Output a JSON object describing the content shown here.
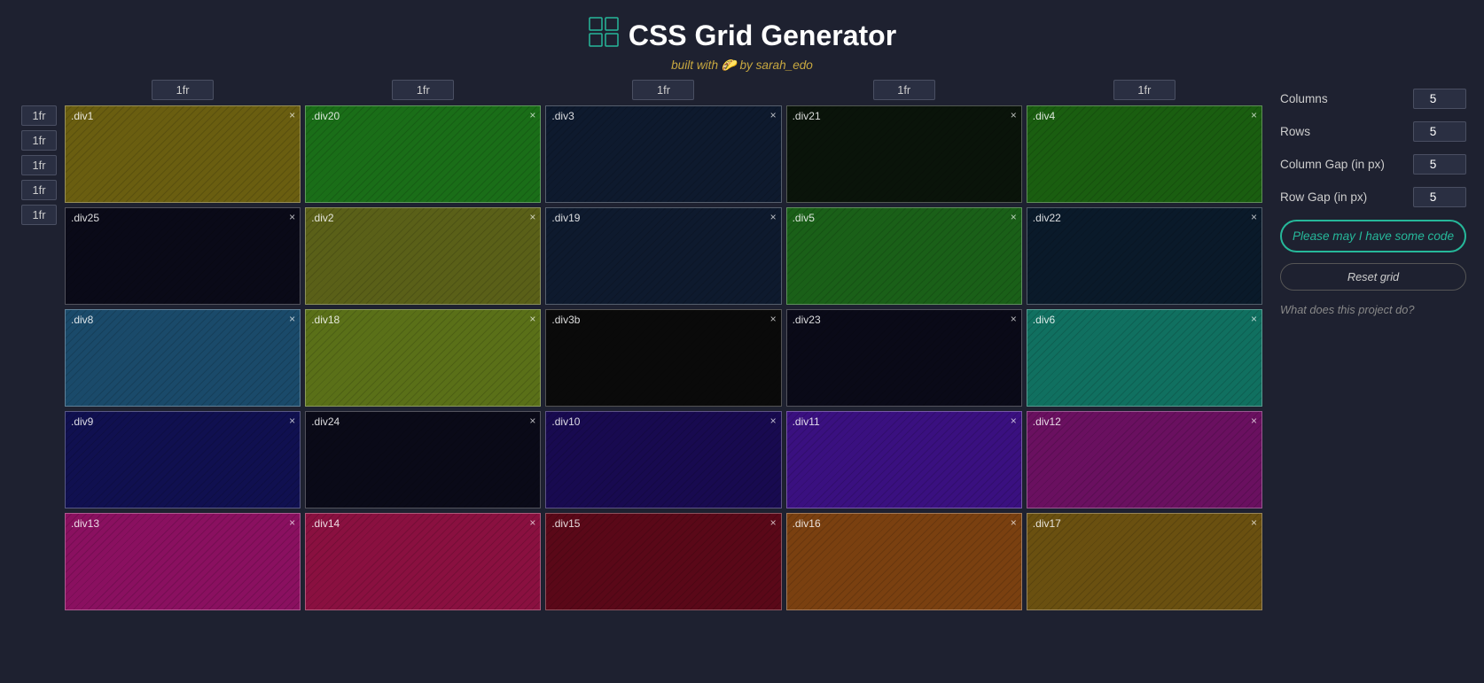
{
  "header": {
    "title": "CSS Grid Generator",
    "subtitle": "built with 🌮 by sarah_edo"
  },
  "column_labels": [
    "1fr",
    "1fr",
    "1fr",
    "1fr",
    "1fr"
  ],
  "row_labels": [
    "1fr",
    "1fr",
    "1fr",
    "1fr",
    "1fr"
  ],
  "grid_cells": [
    {
      "id": "div1",
      "color": "#6b6010",
      "row": 1,
      "col": 1
    },
    {
      "id": "div20",
      "color": "#1e6e18",
      "row": 1,
      "col": 2
    },
    {
      "id": "div3",
      "color": "#0a1a2a",
      "row": 1,
      "col": 3
    },
    {
      "id": "div21",
      "color": "#0a1a0a",
      "row": 1,
      "col": 4
    },
    {
      "id": "div4",
      "color": "#1a6010",
      "row": 1,
      "col": 5
    },
    {
      "id": "div25",
      "color": "#0a0a18",
      "row": 2,
      "col": 1
    },
    {
      "id": "div2",
      "color": "#5a6018",
      "row": 2,
      "col": 2
    },
    {
      "id": "div19",
      "color": "#0a1a2a",
      "row": 2,
      "col": 3
    },
    {
      "id": "div5",
      "color": "#1a6018",
      "row": 2,
      "col": 4
    },
    {
      "id": "div22",
      "color": "#0a1a2a",
      "row": 2,
      "col": 5
    },
    {
      "id": "div8",
      "color": "#1a4a6a",
      "row": 3,
      "col": 1
    },
    {
      "id": "div18",
      "color": "#5a7018",
      "row": 3,
      "col": 2
    },
    {
      "id": "div3b",
      "color": "#0a0a0a",
      "row": 3,
      "col": 3
    },
    {
      "id": "div23",
      "color": "#0a0a18",
      "row": 3,
      "col": 4
    },
    {
      "id": "div6",
      "color": "#107060",
      "row": 3,
      "col": 5
    },
    {
      "id": "div9",
      "color": "#101050",
      "row": 4,
      "col": 1
    },
    {
      "id": "div24",
      "color": "#0a0a18",
      "row": 4,
      "col": 2
    },
    {
      "id": "div10",
      "color": "#180a50",
      "row": 4,
      "col": 3
    },
    {
      "id": "div11",
      "color": "#3a1080",
      "row": 4,
      "col": 4
    },
    {
      "id": "div12",
      "color": "#6a1060",
      "row": 4,
      "col": 5
    },
    {
      "id": "div13",
      "color": "#8a1060",
      "row": 5,
      "col": 1
    },
    {
      "id": "div14",
      "color": "#8a1040",
      "row": 5,
      "col": 2
    },
    {
      "id": "div15",
      "color": "#5a0818",
      "row": 5,
      "col": 3
    },
    {
      "id": "div16",
      "color": "#7a4010",
      "row": 5,
      "col": 4
    },
    {
      "id": "div17",
      "color": "#6a5010",
      "row": 5,
      "col": 5
    }
  ],
  "sidebar": {
    "columns_label": "Columns",
    "columns_value": "5",
    "rows_label": "Rows",
    "rows_value": "5",
    "col_gap_label": "Column Gap (in px)",
    "col_gap_value": "5",
    "row_gap_label": "Row Gap (in px)",
    "row_gap_value": "5",
    "code_button_label": "Please may I have some code",
    "reset_button_label": "Reset grid",
    "what_label": "What does this project do?"
  }
}
